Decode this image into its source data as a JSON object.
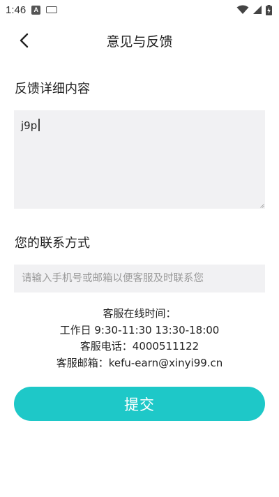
{
  "status_bar": {
    "time": "1:46",
    "notification_icons": [
      "a-notification-icon",
      "keyboard-icon"
    ],
    "system_icons": [
      "wifi-icon",
      "cell-signal-icon",
      "battery-charging-icon"
    ]
  },
  "header": {
    "title": "意见与反馈",
    "back_icon": "chevron-left-icon"
  },
  "feedback": {
    "label": "反馈详细内容",
    "value": "j9p"
  },
  "contact": {
    "label": "您的联系方式",
    "placeholder": "请输入手机号或邮箱以便客服及时联系您",
    "value": ""
  },
  "service_info": {
    "hours_title": "客服在线时间：",
    "hours": "工作日 9:30-11:30 13:30-18:00",
    "phone": "客服电话：4000511122",
    "email": "客服邮箱：kefu-earn@xinyi99.cn"
  },
  "submit": {
    "label": "提交"
  },
  "colors": {
    "accent": "#1ec8c8",
    "input_bg": "#f1f1f3",
    "placeholder": "#9a9a9a",
    "text": "#222222"
  }
}
